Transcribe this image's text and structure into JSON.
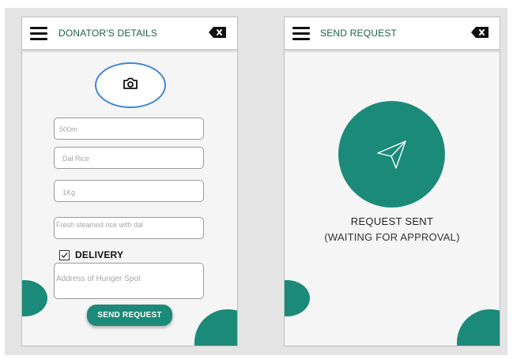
{
  "donor_screen": {
    "title": "DONATOR'S DETAILS",
    "fields": {
      "quantity": "500m",
      "food_name": "Dal Rice",
      "weight": "1Kg",
      "description": "Fresh steamed rice with dal",
      "address_placeholder": "Address of Hunger Spot"
    },
    "delivery": {
      "label": "DELIVERY",
      "checked": true
    },
    "send_button": "SEND REQUEST",
    "icons": [
      "menu-icon",
      "close-icon",
      "camera-icon",
      "checkmark-icon"
    ]
  },
  "request_screen": {
    "title": "SEND REQUEST",
    "status_title": "REQUEST SENT",
    "status_subtitle": "(WAITING FOR APPROVAL)",
    "icons": [
      "menu-icon",
      "close-icon",
      "send-icon"
    ]
  },
  "colors": {
    "accent": "#1b8a78",
    "title_text": "#1a5f4e",
    "camera_outline": "#3d87d6",
    "background": "#e4e4e4"
  }
}
